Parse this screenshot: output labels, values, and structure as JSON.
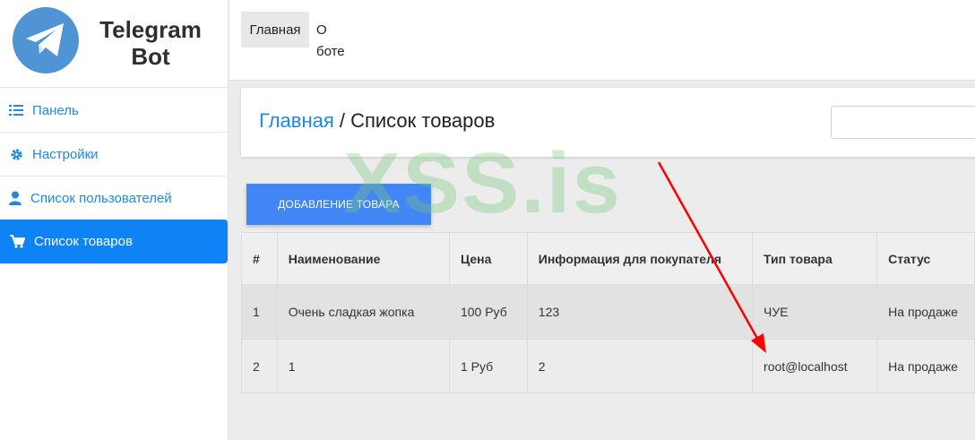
{
  "brand": {
    "line1": "Telegram",
    "line2": "Bot"
  },
  "sidebar": {
    "items": [
      {
        "label": "Панель",
        "icon": "list-check-icon"
      },
      {
        "label": "Настройки",
        "icon": "gear-icon"
      },
      {
        "label": "Список пользователей",
        "icon": "user-icon"
      },
      {
        "label": "Список товаров",
        "icon": "cart-icon",
        "active": true
      }
    ]
  },
  "topbar": {
    "home": "Главная",
    "about": "О боте"
  },
  "breadcrumb": {
    "home": "Главная",
    "separator": " / ",
    "current": "Список товаров"
  },
  "search": {
    "placeholder": ""
  },
  "add_button": "ДОБАВЛЕНИЕ ТОВАРА",
  "table": {
    "headers": [
      "#",
      "Наименование",
      "Цена",
      "Информация для покупателя",
      "Тип товара",
      "Статус"
    ],
    "rows": [
      [
        "1",
        "Очень сладкая жопка",
        "100 Руб",
        "123",
        "ЧУЕ",
        "На продаже"
      ],
      [
        "2",
        "1",
        "1 Руб",
        "2",
        "root@localhost",
        "На продаже"
      ]
    ]
  },
  "watermark": "XSS.is",
  "colors": {
    "accent": "#1e88e5",
    "active_bg": "#0d83f6",
    "button": "#4285f4",
    "arrow": "#ff0000"
  }
}
